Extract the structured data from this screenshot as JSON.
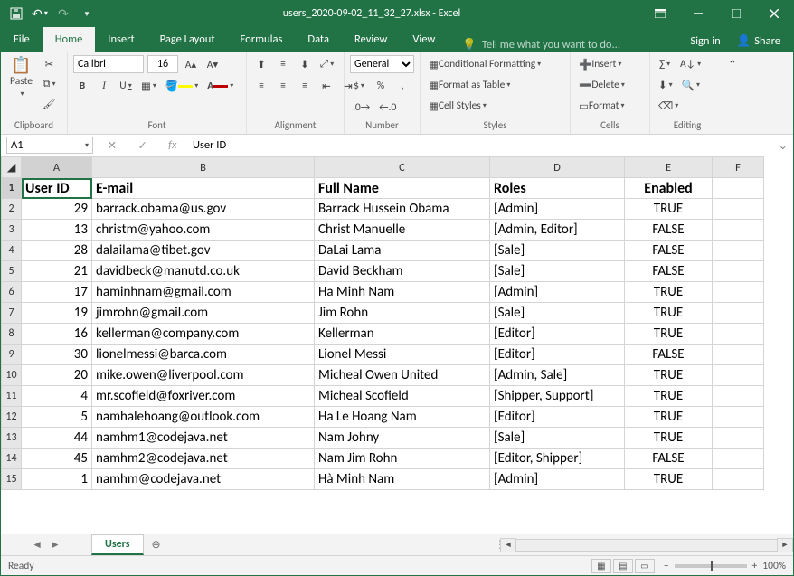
{
  "app": {
    "title": "users_2020-09-02_11_32_27.xlsx - Excel"
  },
  "tabs": {
    "file": "File",
    "home": "Home",
    "insert": "Insert",
    "layout": "Page Layout",
    "formulas": "Formulas",
    "data": "Data",
    "review": "Review",
    "view": "View",
    "tell": "Tell me what you want to do...",
    "signin": "Sign in",
    "share": "Share"
  },
  "ribbon": {
    "clipboard_paste": "Paste",
    "font_name": "Calibri",
    "font_size": "16",
    "number_format": "General",
    "styles_cond": "Conditional Formatting",
    "styles_table": "Format as Table",
    "styles_cell": "Cell Styles",
    "cells_insert": "Insert",
    "cells_delete": "Delete",
    "cells_format": "Format",
    "groups": {
      "clipboard": "Clipboard",
      "font": "Font",
      "alignment": "Alignment",
      "number": "Number",
      "styles": "Styles",
      "cells": "Cells",
      "editing": "Editing"
    }
  },
  "namebox": "A1",
  "formula": "User ID",
  "columns": [
    "A",
    "B",
    "C",
    "D",
    "E",
    "F"
  ],
  "headers": {
    "user_id": "User ID",
    "email": "E-mail",
    "fullname": "Full Name",
    "roles": "Roles",
    "enabled": "Enabled"
  },
  "rows": [
    {
      "id": "29",
      "email": "barrack.obama@us.gov",
      "name": "Barrack Hussein Obama",
      "roles": "[Admin]",
      "enabled": "TRUE"
    },
    {
      "id": "13",
      "email": "christm@yahoo.com",
      "name": "Christ Manuelle",
      "roles": "[Admin, Editor]",
      "enabled": "FALSE"
    },
    {
      "id": "28",
      "email": "dalailama@tibet.gov",
      "name": "DaLai Lama",
      "roles": "[Sale]",
      "enabled": "FALSE"
    },
    {
      "id": "21",
      "email": "davidbeck@manutd.co.uk",
      "name": "David Beckham",
      "roles": "[Sale]",
      "enabled": "FALSE"
    },
    {
      "id": "17",
      "email": "haminhnam@gmail.com",
      "name": "Ha Minh Nam",
      "roles": "[Admin]",
      "enabled": "TRUE"
    },
    {
      "id": "19",
      "email": "jimrohn@gmail.com",
      "name": "Jim Rohn",
      "roles": "[Sale]",
      "enabled": "TRUE"
    },
    {
      "id": "16",
      "email": "kellerman@company.com",
      "name": "Kellerman",
      "roles": "[Editor]",
      "enabled": "TRUE"
    },
    {
      "id": "30",
      "email": "lionelmessi@barca.com",
      "name": "Lionel Messi",
      "roles": "[Editor]",
      "enabled": "FALSE"
    },
    {
      "id": "20",
      "email": "mike.owen@liverpool.com",
      "name": "Micheal Owen United",
      "roles": "[Admin, Sale]",
      "enabled": "TRUE"
    },
    {
      "id": "4",
      "email": "mr.scofield@foxriver.com",
      "name": "Micheal Scofield",
      "roles": "[Shipper, Support]",
      "enabled": "TRUE"
    },
    {
      "id": "5",
      "email": "namhalehoang@outlook.com",
      "name": "Ha Le Hoang Nam",
      "roles": "[Editor]",
      "enabled": "TRUE"
    },
    {
      "id": "44",
      "email": "namhm1@codejava.net",
      "name": "Nam Johny",
      "roles": "[Sale]",
      "enabled": "TRUE"
    },
    {
      "id": "45",
      "email": "namhm2@codejava.net",
      "name": "Nam Jim Rohn",
      "roles": "[Editor, Shipper]",
      "enabled": "FALSE"
    },
    {
      "id": "1",
      "email": "namhm@codejava.net",
      "name": "Hà Minh Nam",
      "roles": "[Admin]",
      "enabled": "TRUE"
    }
  ],
  "sheet_tab": "Users",
  "status": {
    "ready": "Ready",
    "zoom": "100%"
  }
}
